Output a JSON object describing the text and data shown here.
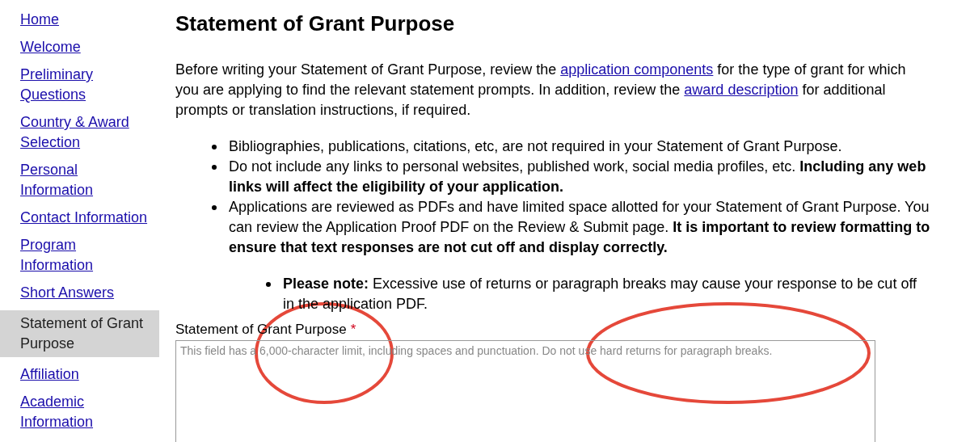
{
  "sidebar": {
    "items": [
      {
        "label": "Home",
        "selected": false
      },
      {
        "label": "Welcome",
        "selected": false
      },
      {
        "label": "Preliminary Questions",
        "selected": false
      },
      {
        "label": "Country & Award Selection",
        "selected": false
      },
      {
        "label": "Personal Information",
        "selected": false
      },
      {
        "label": "Contact Information",
        "selected": false
      },
      {
        "label": "Program Information",
        "selected": false
      },
      {
        "label": "Short Answers",
        "selected": false
      },
      {
        "label": "Statement of Grant Purpose",
        "selected": true
      },
      {
        "label": "Affiliation",
        "selected": false
      },
      {
        "label": "Academic Information",
        "selected": false
      }
    ]
  },
  "main": {
    "title": "Statement of Grant Purpose",
    "intro": [
      {
        "kind": "text",
        "text": "Before writing your Statement of Grant Purpose, review the "
      },
      {
        "kind": "link",
        "text": "application components"
      },
      {
        "kind": "text",
        "text": " for the type of grant for which you are applying to find the relevant statement prompts. In addition, review the "
      },
      {
        "kind": "link",
        "text": "award description"
      },
      {
        "kind": "text",
        "text": " for additional prompts or translation instructions, if required."
      }
    ],
    "bullets": [
      "Bibliographies, publications, citations, etc, are not required in your Statement of Grant Purpose.",
      "Do not include any links to personal websites, published work, social media profiles, etc. **Including any web links will affect the eligibility of your application.**",
      "Applications are reviewed as PDFs and have limited space allotted for your Statement of Grant Purpose. You can review the Application Proof PDF on the Review & Submit page. **It is important to review formatting to ensure that text responses are not cut off and display correctly.**"
    ],
    "sub_bullets": [
      "**Please note:** Excessive use of returns or paragraph breaks may cause your response to be cut off in the application PDF."
    ],
    "field": {
      "label": "Statement of Grant Purpose",
      "required": true,
      "required_mark": "*",
      "placeholder": "This field has a 6,000-character limit, including spaces and punctuation. Do not use hard returns for paragraph breaks."
    }
  }
}
